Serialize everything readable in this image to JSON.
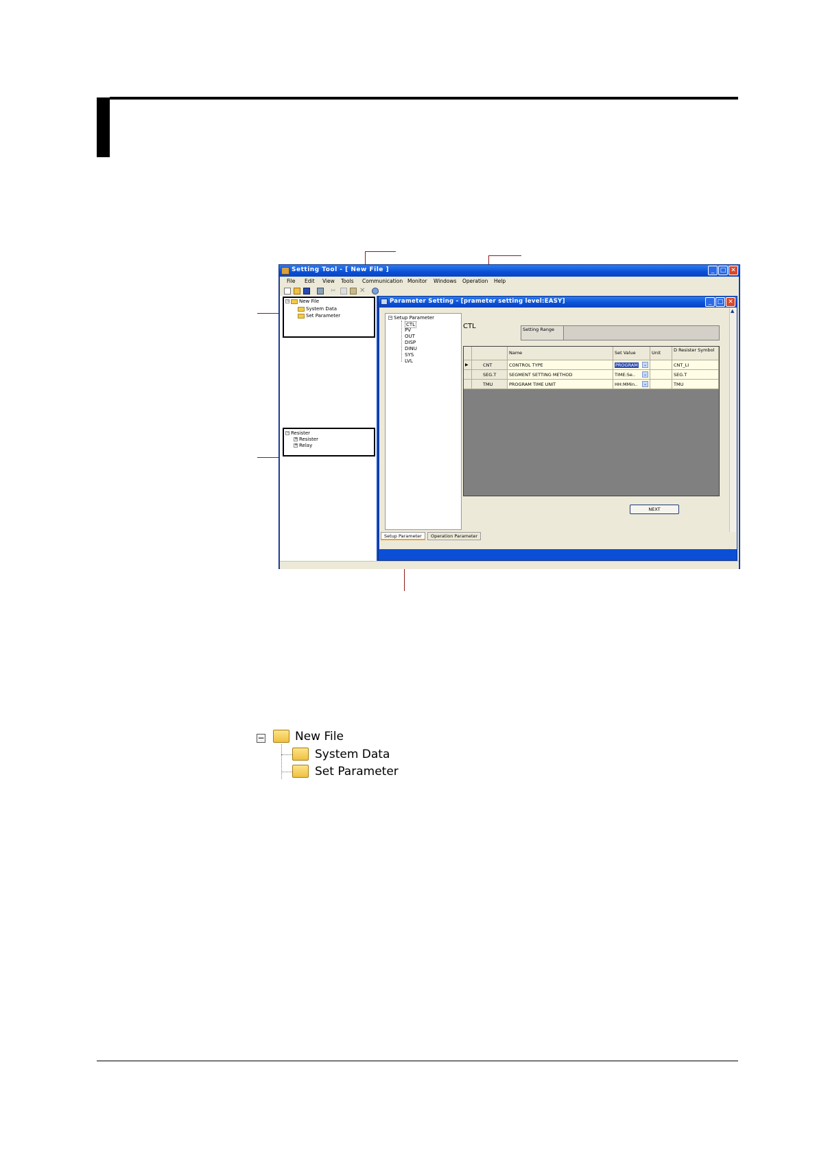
{
  "app": {
    "title": "Setting Tool - [ New File ]",
    "menu": [
      "File",
      "Edit",
      "View",
      "Tools",
      "Communication",
      "Monitor",
      "Windows",
      "Operation",
      "Help"
    ]
  },
  "project_tree": {
    "root": "New File",
    "children": [
      "System Data",
      "Set Parameter"
    ]
  },
  "register_tree": {
    "root": "Resister",
    "children": [
      "Resister",
      "Relay"
    ]
  },
  "child_window": {
    "title": "Parameter Setting - [prameter setting level:EASY]",
    "tree_root": "Setup Parameter",
    "tree_items": [
      "CTL",
      "PV",
      "OUT",
      "DISP",
      "DINU",
      "SYS",
      "LVL"
    ],
    "section_label": "CTL",
    "setting_range_label": "Setting Range",
    "grid": {
      "headers": [
        "Name",
        "Set Value",
        "Unit",
        "D Resister Symbol"
      ],
      "rows": [
        {
          "code": "CNT",
          "name": "CONTROL TYPE",
          "value": "PROGRAM",
          "unit": "",
          "symbol": "CNT_LI"
        },
        {
          "code": "SEG.T",
          "name": "SEGMENT SETTING METHOD",
          "value": "TIME:Se..",
          "unit": "",
          "symbol": "SEG.T"
        },
        {
          "code": "TMU",
          "name": "PROGRAM TIME UNIT",
          "value": "HH:MMin..",
          "unit": "",
          "symbol": "TMU"
        }
      ]
    },
    "next_label": "NEXT",
    "tabs": [
      "Setup Parameter",
      "Operation Parameter"
    ]
  },
  "enlarged_tree": {
    "root": "New File",
    "children": [
      "System Data",
      "Set Parameter"
    ]
  },
  "colors": {
    "titlebar": "#0a4fd6",
    "window_bg": "#ece9d8",
    "callout": "#d0101a",
    "grid_row": "#fffde6",
    "grid_bg": "#808080"
  }
}
